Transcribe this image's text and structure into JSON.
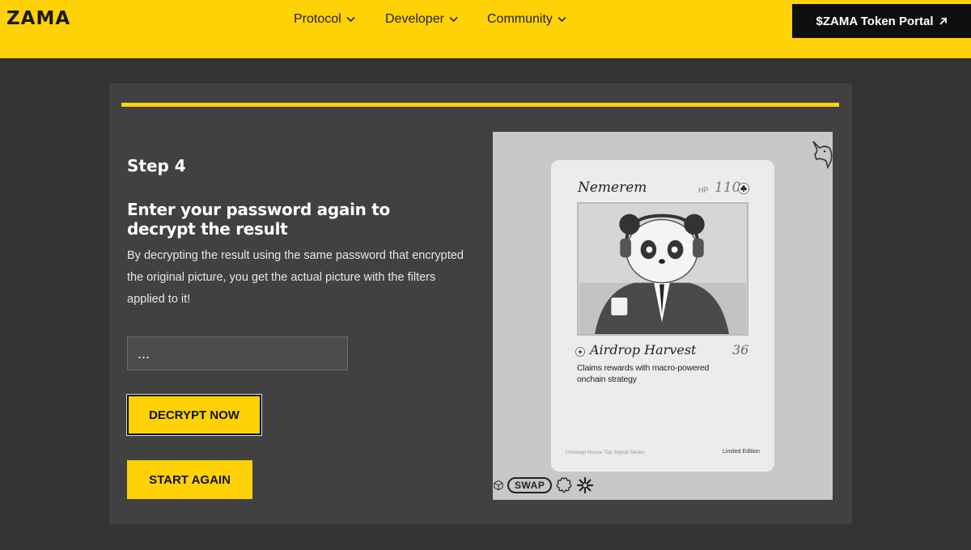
{
  "nav": {
    "logo": "ZAMA",
    "items": [
      {
        "label": "Protocol"
      },
      {
        "label": "Developer"
      },
      {
        "label": "Community"
      }
    ],
    "portal_label": "$ZAMA Token Portal"
  },
  "main": {
    "step": "Step 4",
    "heading": "Enter your password again to decrypt the result",
    "description": "By decrypting the result using the same password that encrypted the original picture, you get the actual picture with the filters applied to it!",
    "password_value": "...",
    "decrypt_label": "DECRYPT NOW",
    "restart_label": "START AGAIN"
  },
  "card": {
    "name": "Nemerem",
    "hp_label": "HP",
    "hp_value": "110",
    "ability": "Airdrop Harvest",
    "ability_cost": "36",
    "ability_desc": "Claims rewards with macro-powered onchain strategy",
    "series": "Uniswap House Top Signal Series",
    "edition": "Limited Edition",
    "swap_label": "SWAP"
  },
  "colors": {
    "accent": "#FFD208",
    "background": "#333333",
    "panel": "#414141"
  }
}
